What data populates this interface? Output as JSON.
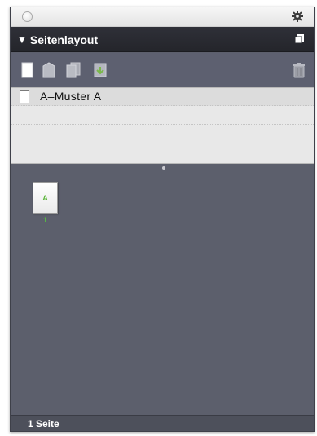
{
  "panel": {
    "title": "Seitenlayout",
    "toolbar": {
      "icons": [
        "new-page-icon",
        "master-page-icon",
        "duplicate-icon",
        "move-icon",
        "trash-icon"
      ]
    },
    "masters": [
      {
        "label": "A–Muster A"
      }
    ],
    "pages": [
      {
        "thumb_label": "A",
        "number": "1"
      }
    ],
    "status": "1 Seite",
    "colors": {
      "panel_bg": "#5c5f6c",
      "header_bg": "#2f3038",
      "list_bg": "#e8e8e8",
      "page_label": "#5bb53a"
    }
  }
}
